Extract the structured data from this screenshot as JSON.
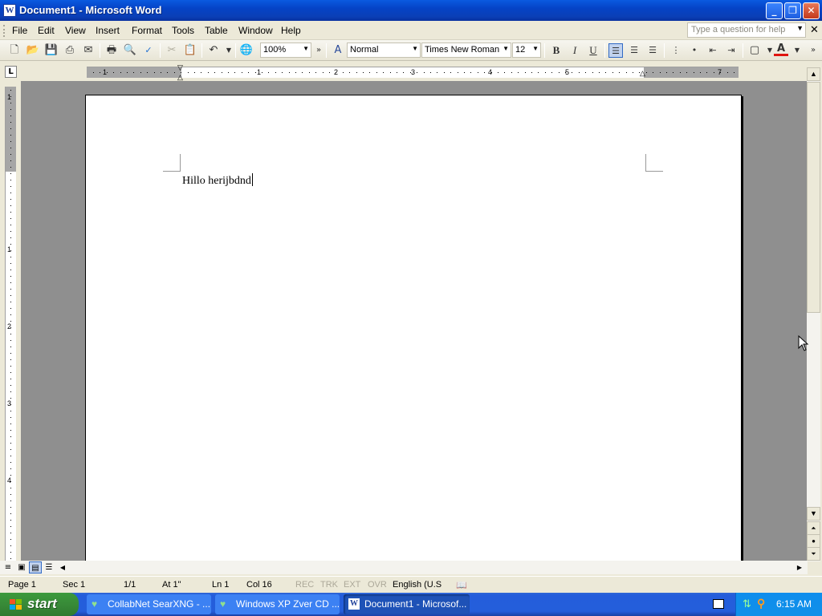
{
  "window": {
    "title": "Document1 - Microsoft Word"
  },
  "menubar": {
    "items": [
      "File",
      "Edit",
      "View",
      "Insert",
      "Format",
      "Tools",
      "Table",
      "Window",
      "Help"
    ],
    "help_placeholder": "Type a question for help"
  },
  "toolbar": {
    "zoom": "100%",
    "style": "Normal",
    "font": "Times New Roman",
    "size": "12",
    "bold": "B",
    "italic": "I",
    "underline": "U",
    "font_color_letter": "A",
    "font_color": "#e0150f"
  },
  "ruler": {
    "h_numbers": [
      "1",
      "1",
      "2",
      "3",
      "4",
      "5",
      "7"
    ],
    "v_numbers": [
      "1",
      "1",
      "2",
      "3",
      "4"
    ]
  },
  "document": {
    "text": "Hillo herijbdnd"
  },
  "status": {
    "page": "Page  1",
    "sec": "Sec  1",
    "pages": "1/1",
    "at": "At  1\"",
    "ln": "Ln  1",
    "col": "Col  16",
    "rec": "REC",
    "trk": "TRK",
    "ext": "EXT",
    "ovr": "OVR",
    "language": "English (U.S"
  },
  "taskbar": {
    "start": "start",
    "tasks": [
      "CollabNet SearXNG - ...",
      "Windows XP Zver CD ...",
      "Document1 - Microsof..."
    ],
    "clock": "6:15 AM"
  }
}
